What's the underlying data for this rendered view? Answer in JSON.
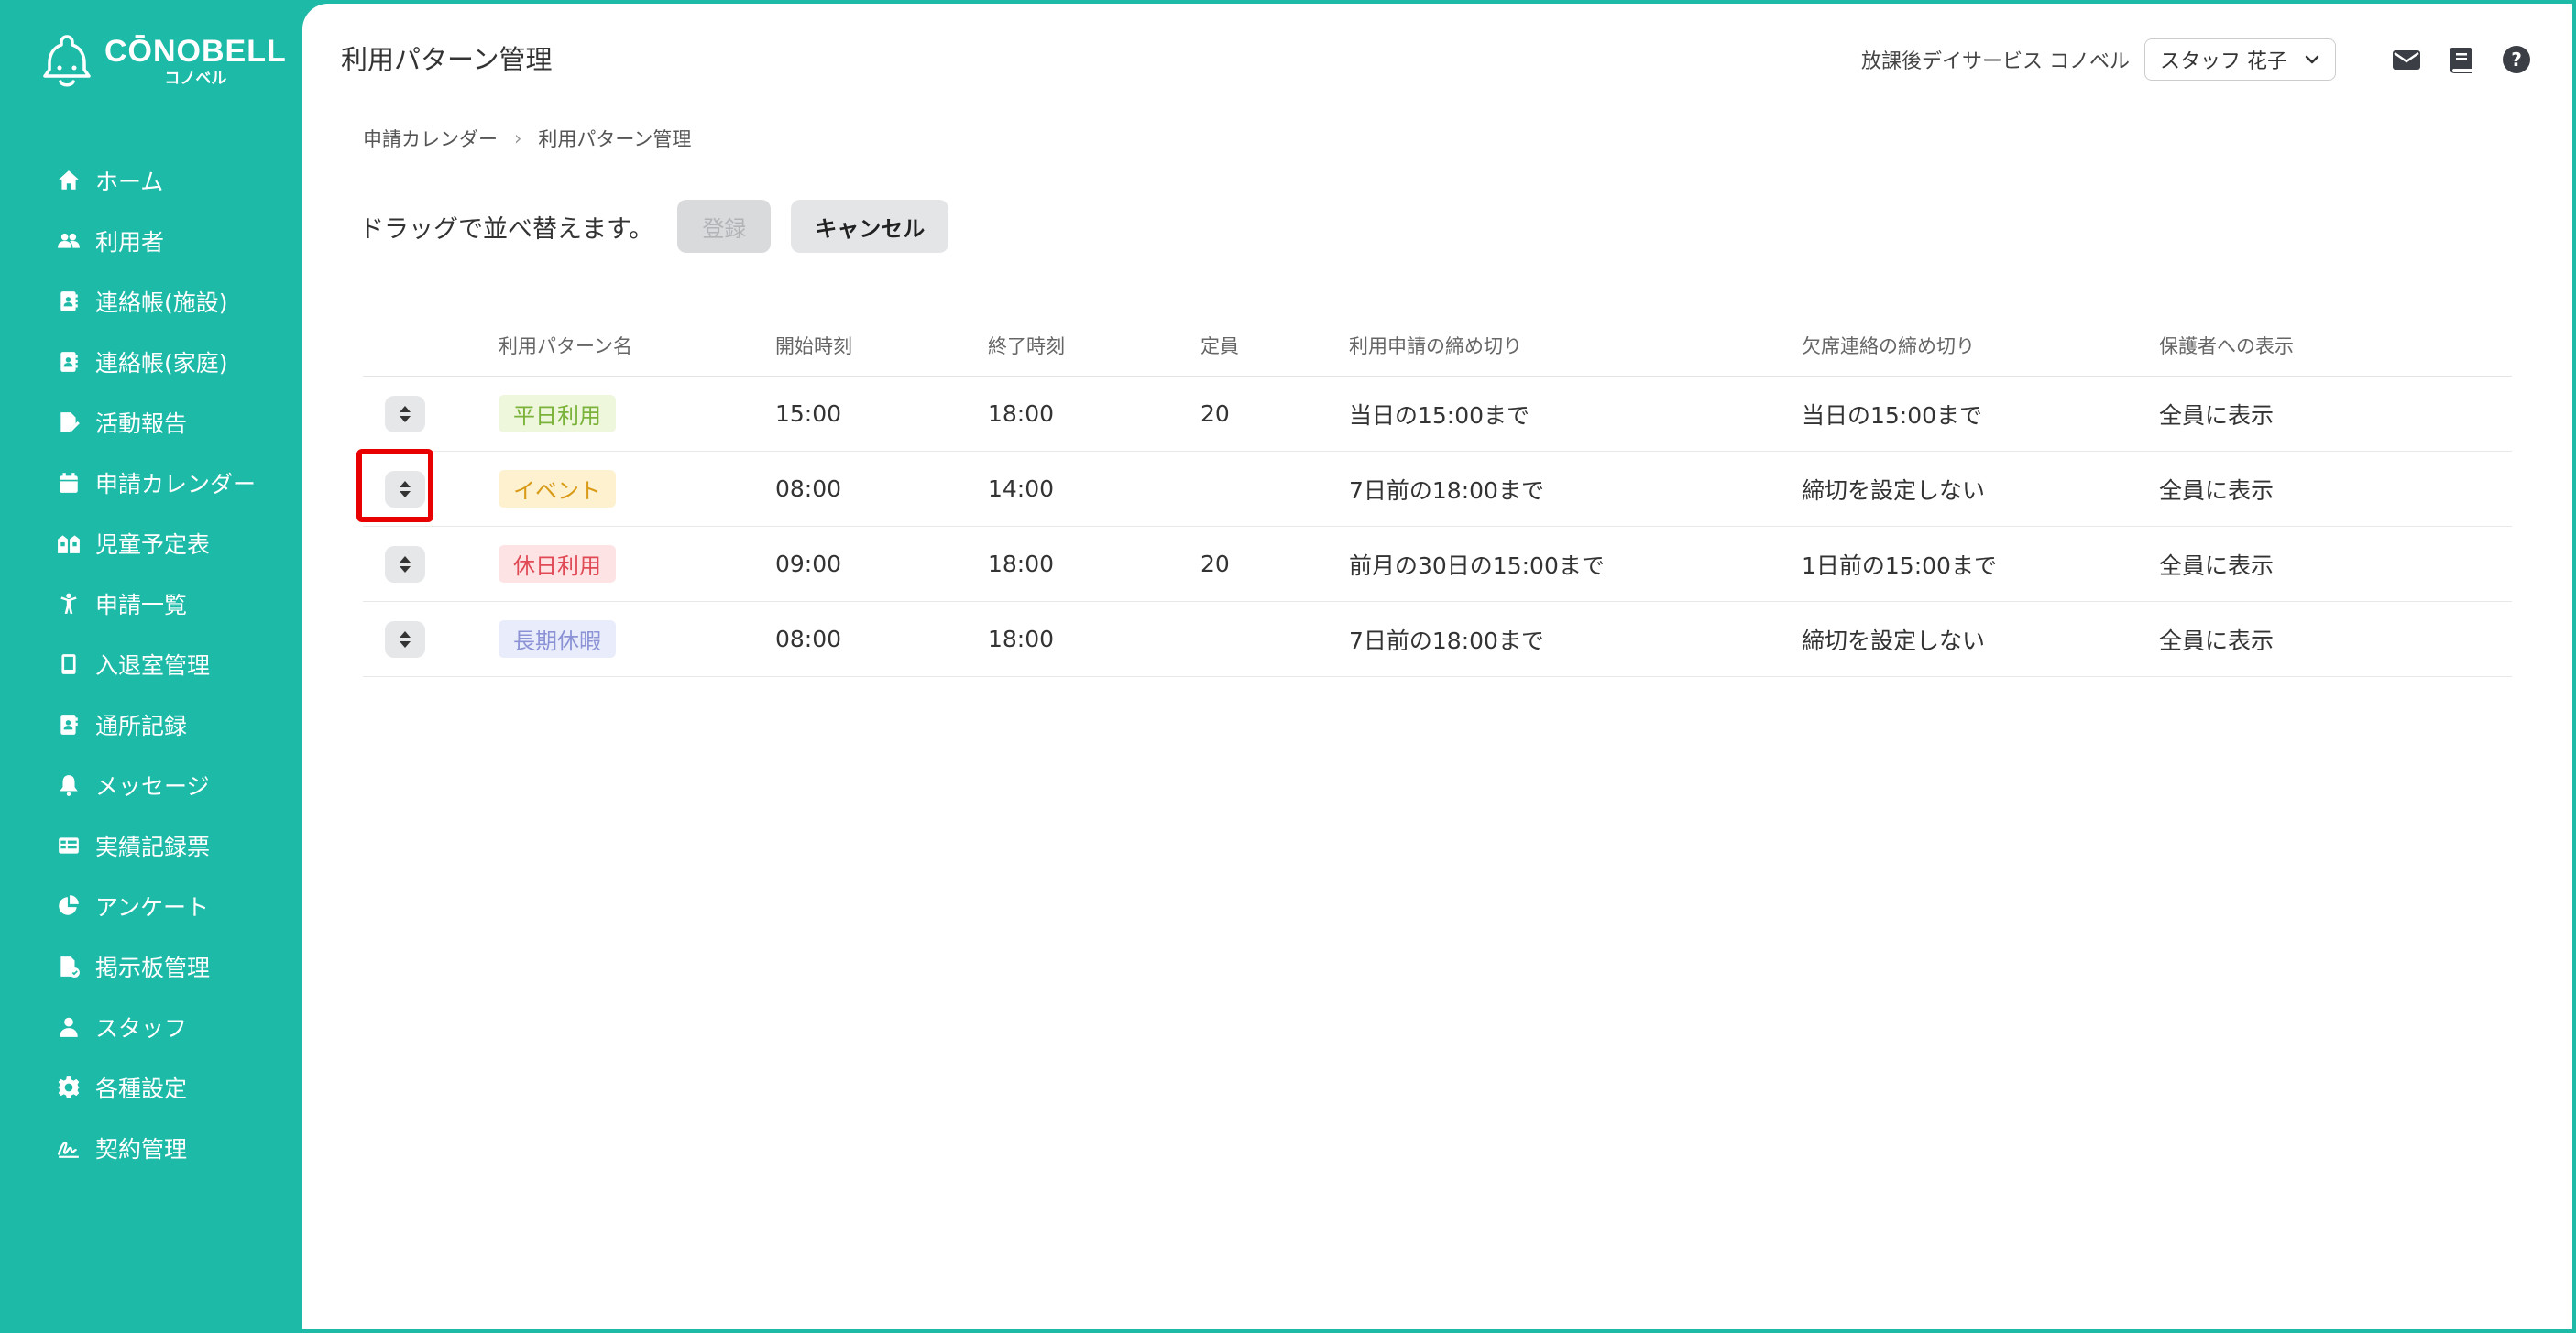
{
  "app": {
    "logo_main": "CŌNOBELL",
    "logo_sub": "コノベル"
  },
  "sidebar": {
    "items": [
      {
        "label": "ホーム",
        "icon": "home-icon"
      },
      {
        "label": "利用者",
        "icon": "users-icon"
      },
      {
        "label": "連絡帳(施設)",
        "icon": "contact-book-icon"
      },
      {
        "label": "連絡帳(家庭)",
        "icon": "contact-book-icon"
      },
      {
        "label": "活動報告",
        "icon": "report-edit-icon"
      },
      {
        "label": "申請カレンダー",
        "icon": "calendar-icon"
      },
      {
        "label": "児童予定表",
        "icon": "children-schedule-icon"
      },
      {
        "label": "申請一覧",
        "icon": "child-icon"
      },
      {
        "label": "入退室管理",
        "icon": "tablet-icon"
      },
      {
        "label": "通所記録",
        "icon": "record-book-icon"
      },
      {
        "label": "メッセージ",
        "icon": "bell-icon"
      },
      {
        "label": "実績記録票",
        "icon": "table-icon"
      },
      {
        "label": "アンケート",
        "icon": "pie-chart-icon"
      },
      {
        "label": "掲示板管理",
        "icon": "board-icon"
      },
      {
        "label": "スタッフ",
        "icon": "staff-icon"
      },
      {
        "label": "各種設定",
        "icon": "gear-icon"
      },
      {
        "label": "契約管理",
        "icon": "signature-icon"
      }
    ]
  },
  "header": {
    "title": "利用パターン管理",
    "org_name": "放課後デイサービス コノベル",
    "user_name": "スタッフ 花子"
  },
  "breadcrumb": {
    "parent": "申請カレンダー",
    "current": "利用パターン管理"
  },
  "toolbar": {
    "message": "ドラッグで並べ替えます。",
    "register_label": "登録",
    "cancel_label": "キャンセル"
  },
  "table": {
    "headers": [
      "利用パターン名",
      "開始時刻",
      "終了時刻",
      "定員",
      "利用申請の締め切り",
      "欠席連絡の締め切り",
      "保護者への表示"
    ],
    "rows": [
      {
        "name": "平日利用",
        "badge_bg": "#eef6dc",
        "badge_fg": "#7bb33a",
        "start": "15:00",
        "end": "18:00",
        "capacity": "20",
        "apply_deadline": "当日の15:00まで",
        "absence_deadline": "当日の15:00まで",
        "display": "全員に表示"
      },
      {
        "name": "イベント",
        "badge_bg": "#fdf1cf",
        "badge_fg": "#d99a17",
        "start": "08:00",
        "end": "14:00",
        "capacity": "",
        "apply_deadline": "7日前の18:00まで",
        "absence_deadline": "締切を設定しない",
        "display": "全員に表示"
      },
      {
        "name": "休日利用",
        "badge_bg": "#fde3e4",
        "badge_fg": "#e04a55",
        "start": "09:00",
        "end": "18:00",
        "capacity": "20",
        "apply_deadline": "前月の30日の15:00まで",
        "absence_deadline": "1日前の15:00まで",
        "display": "全員に表示"
      },
      {
        "name": "長期休暇",
        "badge_bg": "#e9ecfa",
        "badge_fg": "#8b93d6",
        "start": "08:00",
        "end": "18:00",
        "capacity": "",
        "apply_deadline": "7日前の18:00まで",
        "absence_deadline": "締切を設定しない",
        "display": "全員に表示"
      }
    ]
  },
  "colors": {
    "sidebar_bg": "#1dbaa8",
    "highlight": "#e80000"
  }
}
